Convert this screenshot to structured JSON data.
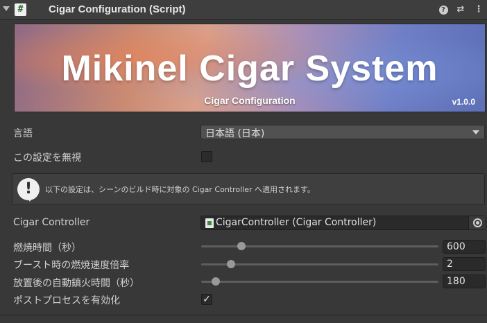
{
  "header": {
    "title": "Cigar Configuration (Script)",
    "script_icon": "#",
    "help_glyph": "?",
    "preset_glyph": "⇄",
    "menu_glyph": "⋮"
  },
  "banner": {
    "title": "Mikinel Cigar System",
    "subtitle": "Cigar Configuration",
    "version": "v1.0.0"
  },
  "fields": {
    "language_label": "言語",
    "language_value": "日本語 (日本)",
    "ignore_label": "この設定を無視",
    "ignore_checked": false,
    "help_text": "以下の設定は、シーンのビルド時に対象の Cigar Controller へ適用されます。",
    "controller_label": "Cigar Controller",
    "controller_value": "CigarController (Cigar Controller)",
    "burn_label": "燃焼時間（秒）",
    "burn_value": "600",
    "burn_fraction": 0.17,
    "boost_label": "ブースト時の燃焼速度倍率",
    "boost_value": "2",
    "boost_fraction": 0.125,
    "idle_label": "放置後の自動鎮火時間（秒）",
    "idle_value": "180",
    "idle_fraction": 0.06,
    "postprocess_label": "ポストプロセスを有効化",
    "postprocess_checked": true,
    "check_glyph": "✓"
  }
}
